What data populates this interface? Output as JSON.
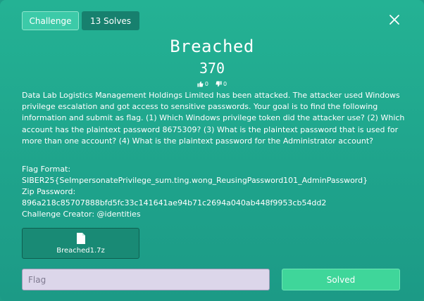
{
  "tabs": [
    {
      "label": "Challenge",
      "active": true
    },
    {
      "label": "13 Solves",
      "active": false
    }
  ],
  "challenge": {
    "title": "Breached",
    "points": "370",
    "upvotes": "0",
    "downvotes": "0",
    "description": "Data Lab Logistics Management Holdings Limited has been attacked. The attacker used Windows privilege escalation and got access to sensitive passwords. Your goal is to find the following information and submit as flag. (1) Which Windows privilege token did the attacker use? (2) Which account has the plaintext password 8675309? (3) What is the plaintext password that is used for more than one account? (4) What is the plaintext password for the Administrator account?",
    "flag_format_label": "Flag Format:",
    "flag_format_value": "SIBER25{SeImpersonatePrivilege_sum.ting.wong_ReusingPassword101_AdminPassword}",
    "zip_password_label": "Zip Password:",
    "zip_password_value": "896a218c85707888bfd5fc33c141641ae94b71c2694a040ab448f9953cb54dd2",
    "creator": "Challenge Creator: @identities"
  },
  "file": {
    "name": "Breached1.7z",
    "icon": "file-icon"
  },
  "flag_input": {
    "placeholder": "Flag",
    "value": ""
  },
  "submit": {
    "label": "Solved"
  },
  "colors": {
    "background": "#24b294",
    "tab_active": "#3ccaa8",
    "tab_inactive": "#17806e",
    "submit": "#3fd69a",
    "input_bg": "#dcd6ea"
  }
}
